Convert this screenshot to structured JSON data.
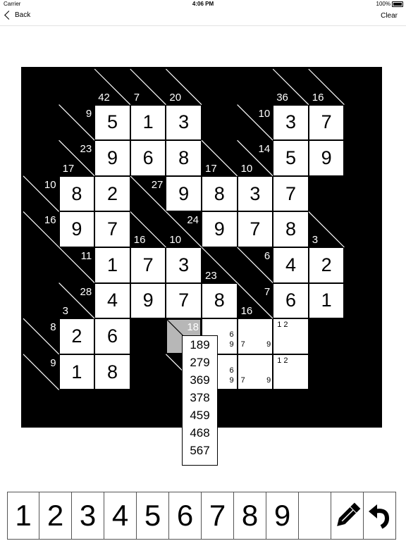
{
  "status_bar": {
    "carrier": "Carrier",
    "time": "4:06 PM",
    "battery": "100%"
  },
  "nav": {
    "back_label": "Back",
    "clear_label": "Clear"
  },
  "colors": {
    "board": "#000000",
    "cell": "#ffffff",
    "selected_clue": "#b7b7b7"
  },
  "grid": {
    "size": 10,
    "filled": [
      {
        "r": 1,
        "c": 2,
        "v": "5"
      },
      {
        "r": 1,
        "c": 3,
        "v": "1"
      },
      {
        "r": 1,
        "c": 4,
        "v": "3"
      },
      {
        "r": 1,
        "c": 7,
        "v": "3"
      },
      {
        "r": 1,
        "c": 8,
        "v": "7"
      },
      {
        "r": 2,
        "c": 2,
        "v": "9"
      },
      {
        "r": 2,
        "c": 3,
        "v": "6"
      },
      {
        "r": 2,
        "c": 4,
        "v": "8"
      },
      {
        "r": 2,
        "c": 7,
        "v": "5"
      },
      {
        "r": 2,
        "c": 8,
        "v": "9"
      },
      {
        "r": 3,
        "c": 1,
        "v": "8"
      },
      {
        "r": 3,
        "c": 2,
        "v": "2"
      },
      {
        "r": 3,
        "c": 4,
        "v": "9"
      },
      {
        "r": 3,
        "c": 5,
        "v": "8"
      },
      {
        "r": 3,
        "c": 6,
        "v": "3"
      },
      {
        "r": 3,
        "c": 7,
        "v": "7"
      },
      {
        "r": 4,
        "c": 1,
        "v": "9"
      },
      {
        "r": 4,
        "c": 2,
        "v": "7"
      },
      {
        "r": 4,
        "c": 5,
        "v": "9"
      },
      {
        "r": 4,
        "c": 6,
        "v": "7"
      },
      {
        "r": 4,
        "c": 7,
        "v": "8"
      },
      {
        "r": 5,
        "c": 2,
        "v": "1"
      },
      {
        "r": 5,
        "c": 3,
        "v": "7"
      },
      {
        "r": 5,
        "c": 4,
        "v": "3"
      },
      {
        "r": 5,
        "c": 7,
        "v": "4"
      },
      {
        "r": 5,
        "c": 8,
        "v": "2"
      },
      {
        "r": 6,
        "c": 2,
        "v": "4"
      },
      {
        "r": 6,
        "c": 3,
        "v": "9"
      },
      {
        "r": 6,
        "c": 4,
        "v": "7"
      },
      {
        "r": 6,
        "c": 5,
        "v": "8"
      },
      {
        "r": 6,
        "c": 7,
        "v": "6"
      },
      {
        "r": 6,
        "c": 8,
        "v": "1"
      },
      {
        "r": 7,
        "c": 1,
        "v": "2"
      },
      {
        "r": 7,
        "c": 2,
        "v": "6"
      },
      {
        "r": 8,
        "c": 1,
        "v": "1"
      },
      {
        "r": 8,
        "c": 2,
        "v": "8"
      }
    ],
    "pencil": [
      {
        "r": 7,
        "c": 5,
        "marks": [
          {
            "t": "6",
            "p": "tr"
          },
          {
            "t": "9",
            "p": "br"
          }
        ]
      },
      {
        "r": 7,
        "c": 6,
        "marks": [
          {
            "t": "7",
            "p": "bl"
          },
          {
            "t": "9",
            "p": "brr"
          }
        ]
      },
      {
        "r": 7,
        "c": 7,
        "marks": [
          {
            "t": "1 2",
            "p": "tl"
          }
        ]
      },
      {
        "r": 8,
        "c": 5,
        "marks": [
          {
            "t": "6",
            "p": "tr"
          },
          {
            "t": "9",
            "p": "br"
          }
        ]
      },
      {
        "r": 8,
        "c": 6,
        "marks": [
          {
            "t": "7",
            "p": "bl"
          },
          {
            "t": "9",
            "p": "brr"
          }
        ]
      },
      {
        "r": 8,
        "c": 7,
        "marks": [
          {
            "t": "1 2",
            "p": "tl"
          }
        ]
      }
    ],
    "clues": [
      {
        "r": 0,
        "c": 2,
        "down": "42"
      },
      {
        "r": 0,
        "c": 3,
        "down": "7"
      },
      {
        "r": 0,
        "c": 4,
        "down": "20"
      },
      {
        "r": 0,
        "c": 7,
        "down": "36"
      },
      {
        "r": 0,
        "c": 8,
        "down": "16"
      },
      {
        "r": 1,
        "c": 1,
        "across": "9"
      },
      {
        "r": 1,
        "c": 6,
        "across": "10"
      },
      {
        "r": 2,
        "c": 1,
        "across": "23",
        "down": "17"
      },
      {
        "r": 2,
        "c": 5,
        "down": "17"
      },
      {
        "r": 2,
        "c": 6,
        "across": "14",
        "down": "10"
      },
      {
        "r": 3,
        "c": 0,
        "across": "10"
      },
      {
        "r": 3,
        "c": 3,
        "across": "27"
      },
      {
        "r": 4,
        "c": 0,
        "across": "16"
      },
      {
        "r": 4,
        "c": 3,
        "down": "16"
      },
      {
        "r": 4,
        "c": 4,
        "across": "24",
        "down": "10"
      },
      {
        "r": 4,
        "c": 8,
        "down": "3"
      },
      {
        "r": 5,
        "c": 1,
        "across": "11"
      },
      {
        "r": 5,
        "c": 5,
        "down": "23"
      },
      {
        "r": 5,
        "c": 6,
        "across": "6"
      },
      {
        "r": 6,
        "c": 1,
        "across": "28",
        "down": "3"
      },
      {
        "r": 6,
        "c": 6,
        "across": "7",
        "down": "16"
      },
      {
        "r": 7,
        "c": 0,
        "across": "8"
      },
      {
        "r": 7,
        "c": 4,
        "across": "18",
        "selected": true
      },
      {
        "r": 8,
        "c": 0,
        "across": "9"
      },
      {
        "r": 8,
        "c": 4,
        "across": ""
      }
    ]
  },
  "combinations": [
    "189",
    "279",
    "369",
    "378",
    "459",
    "468",
    "567"
  ],
  "keypad": {
    "digits": [
      "1",
      "2",
      "3",
      "4",
      "5",
      "6",
      "7",
      "8",
      "9"
    ],
    "blank": "",
    "pencil_icon": "pencil-icon",
    "undo_icon": "undo-icon"
  }
}
